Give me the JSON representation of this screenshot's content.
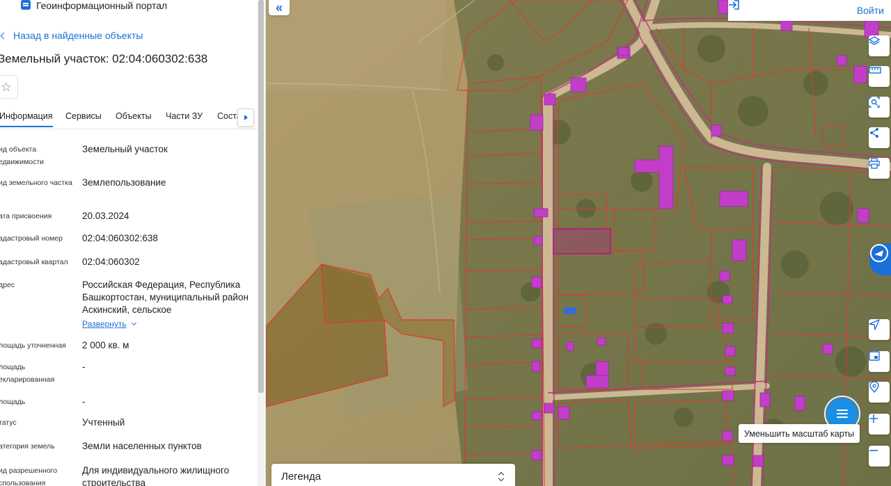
{
  "header": {
    "portal_title": "Геоинформационный портал"
  },
  "nav": {
    "back_label": "Назад в найденные объекты"
  },
  "object": {
    "title": "Земельный участок: 02:04:060302:638"
  },
  "tabs": [
    {
      "label": "Информация",
      "active": true
    },
    {
      "label": "Сервисы",
      "active": false
    },
    {
      "label": "Объекты",
      "active": false
    },
    {
      "label": "Части ЗУ",
      "active": false
    },
    {
      "label": "Соста",
      "active": false
    }
  ],
  "info": {
    "rows": [
      {
        "label": "ид объекта едвижимости",
        "value": "Земельный участок"
      },
      {
        "label": "ид земельного частка",
        "value": "Землепользование"
      },
      {
        "label": "ата присвоения",
        "value": "20.03.2024"
      },
      {
        "label": "адастровый номер",
        "value": "02:04:060302:638"
      },
      {
        "label": "адастровый квартал",
        "value": "02:04:060302"
      },
      {
        "label": "дрес",
        "value": "Российская Федерация, Республика Башкортостан, муниципальный район Аскинский, сельское"
      },
      {
        "label": "лощадь уточненная",
        "value": "2 000 кв. м"
      },
      {
        "label": "лощадь екларированная",
        "value": "-"
      },
      {
        "label": "лощадь",
        "value": "-"
      },
      {
        "label": "татус",
        "value": "Учтенный"
      },
      {
        "label": "атегория земель",
        "value": "Земли населенных пунктов"
      },
      {
        "label": "ид разрешенного спользования",
        "value": "Для индивидуального жилищного строительства"
      }
    ],
    "expand_label": "Развернуть"
  },
  "map": {
    "login_label": "Войти",
    "zoom_out_tooltip": "Уменьшить масштаб карты",
    "legend_label": "Легенда",
    "tools": [
      {
        "icon": "layers-icon"
      },
      {
        "icon": "ruler-icon"
      },
      {
        "icon": "select-area-icon"
      },
      {
        "icon": "share-icon"
      },
      {
        "icon": "print-icon"
      },
      {
        "icon": "locate-icon"
      },
      {
        "icon": "minimap-icon"
      },
      {
        "icon": "pin-search-icon"
      },
      {
        "icon": "zoom-in-icon"
      },
      {
        "icon": "zoom-out-icon"
      }
    ],
    "colors": {
      "accent": "#1b6fd8",
      "parcel_border": "#e0392b",
      "building": "#c23ec8",
      "selected_parcel": "#b0307a"
    }
  }
}
